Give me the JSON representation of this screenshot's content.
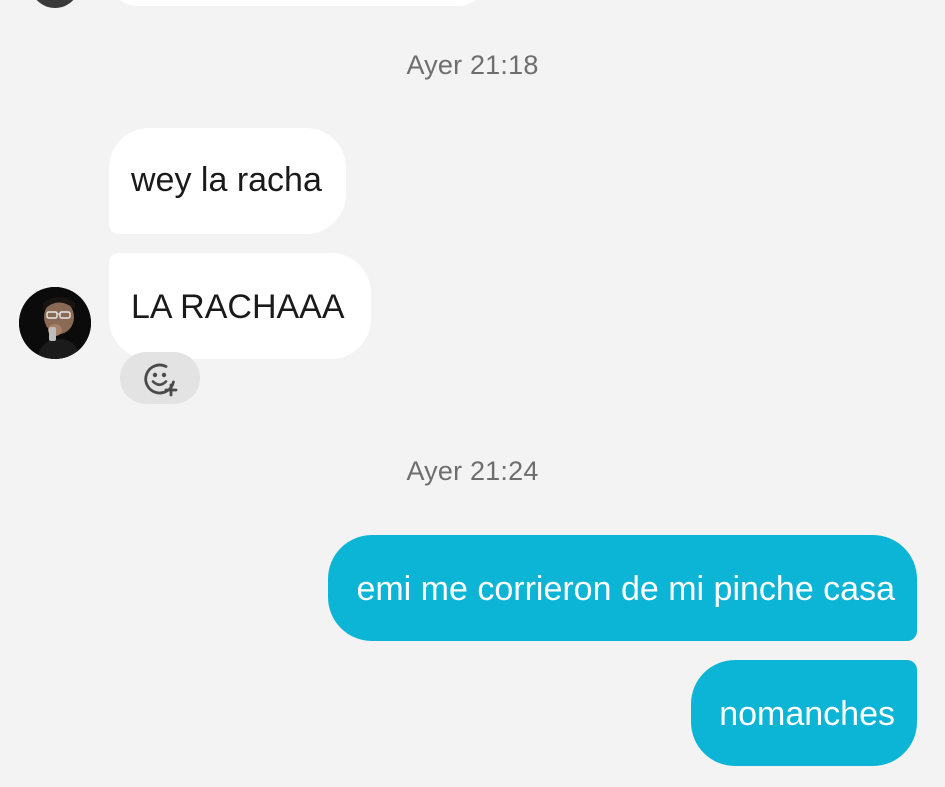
{
  "conversation": {
    "previous_partial": {
      "avatar_icon": "contact-avatar",
      "bubble": "incoming-message-cropped"
    },
    "groups": [
      {
        "timestamp": "Ayer 21:18",
        "messages": [
          {
            "direction": "incoming",
            "text": "wey la racha"
          },
          {
            "direction": "incoming",
            "text": "LA RACHAAA"
          }
        ],
        "sender_avatar_icon": "contact-avatar",
        "reaction_button_icon": "add-reaction-icon"
      },
      {
        "timestamp": "Ayer 21:24",
        "messages": [
          {
            "direction": "outgoing",
            "text": "emi me corrieron de mi pinche casa"
          },
          {
            "direction": "outgoing",
            "text": "nomanches"
          }
        ]
      }
    ]
  },
  "colors": {
    "background": "#f3f3f3",
    "incoming_bubble": "#ffffff",
    "outgoing_bubble": "#0cb4d6",
    "timestamp_text": "#6e6e6e",
    "reaction_button": "#e3e3e3"
  }
}
